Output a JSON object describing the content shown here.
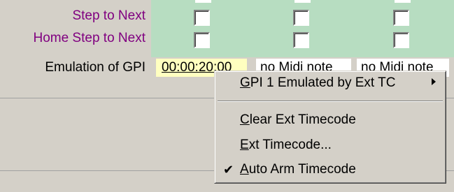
{
  "rows": {
    "step_to_next": {
      "label": "Step to Next"
    },
    "home_step_to_next": {
      "label": "Home Step to Next"
    },
    "emulation_of_gpi": {
      "label": "Emulation of GPI"
    }
  },
  "fields": {
    "timecode": "00:00:20:00",
    "midi_note_1": "no Midi note",
    "midi_note_2": "no Midi note"
  },
  "context_menu": {
    "items": [
      {
        "label_pre": "",
        "mnemonic": "G",
        "label_post": "PI 1 Emulated by Ext TC",
        "has_submenu": true,
        "checked": false
      },
      {
        "label_pre": "",
        "mnemonic": "C",
        "label_post": "lear Ext Timecode",
        "has_submenu": false,
        "checked": false
      },
      {
        "label_pre": "",
        "mnemonic": "E",
        "label_post": "xt Timecode...",
        "has_submenu": false,
        "checked": false
      },
      {
        "label_pre": "",
        "mnemonic": "A",
        "label_post": "uto Arm Timecode",
        "has_submenu": false,
        "checked": true
      }
    ],
    "check_glyph": "✔"
  },
  "colors": {
    "purple_label": "#800080",
    "green_panel": "#b7ddc1",
    "timecode_bg": "#ffffc0",
    "window_bg": "#d4d0c8"
  }
}
